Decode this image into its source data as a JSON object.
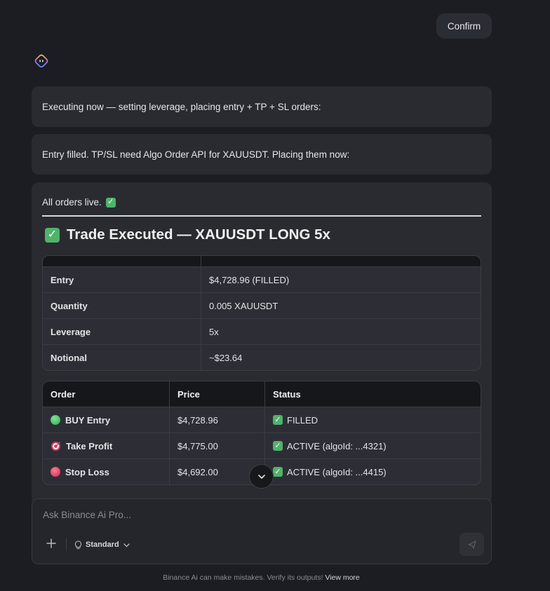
{
  "user_message": {
    "text": "Confirm"
  },
  "assistant": {
    "avatar_icon": "bot-face-icon",
    "messages": [
      "Executing now — setting leverage, placing entry + TP + SL orders:",
      "Entry filled. TP/SL need Algo Order API for XAUUSDT. Placing them now:"
    ],
    "status_line": "All orders live.",
    "heading": "Trade Executed — XAUUSDT LONG 5x",
    "summary_table": {
      "rows": [
        {
          "label": "Entry",
          "value": "$4,728.96 (FILLED)"
        },
        {
          "label": "Quantity",
          "value": "0.005 XAUUSDT"
        },
        {
          "label": "Leverage",
          "value": "5x"
        },
        {
          "label": "Notional",
          "value": "~$23.64"
        }
      ]
    },
    "orders_table": {
      "headers": [
        "Order",
        "Price",
        "Status"
      ],
      "rows": [
        {
          "icon": "green-circle-icon",
          "order": "BUY Entry",
          "price": "$4,728.96",
          "status": "FILLED"
        },
        {
          "icon": "target-icon",
          "order": "Take Profit",
          "price": "$4,775.00",
          "status": "ACTIVE (algoId: ...4321)"
        },
        {
          "icon": "red-circle-icon",
          "order": "Stop Loss",
          "price": "$4,692.00",
          "status": "ACTIVE (algoId: ...4415)"
        }
      ]
    }
  },
  "composer": {
    "placeholder": "Ask Binance Ai Pro...",
    "mode": "Standard"
  },
  "footer": {
    "disclaimer": "Binance Ai can make mistakes. Verify its outputs!",
    "link": "View more"
  },
  "colors": {
    "background": "#1c1d22",
    "bubble": "#2a2b31",
    "check": "#4fb36a",
    "green_dot": "#2ea84f",
    "red_dot": "#d8264f"
  }
}
